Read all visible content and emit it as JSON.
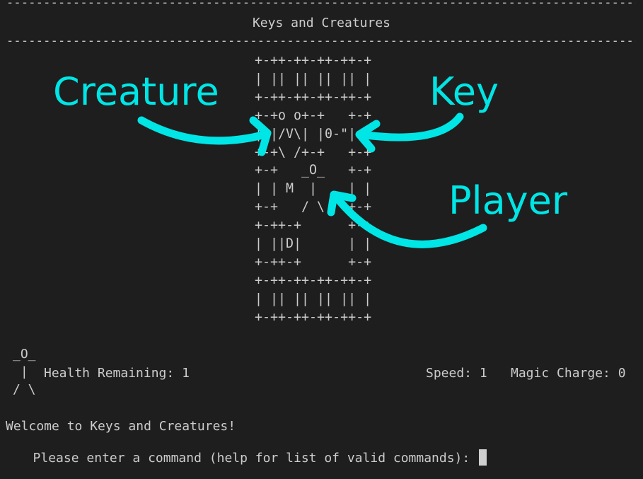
{
  "header": {
    "rule": "---------------------------------------------------------------------------------------------------------",
    "title": "Keys and Creatures"
  },
  "map": {
    "lines": [
      "+-++-++-++-++-+",
      "| || || || || |",
      "+-++-++-++-++-+",
      "+-+o o+-+   +-+",
      "| |/V\\| |0-\"| |",
      "+-+\\ /+-+   +-+",
      "+-+   _O_   +-+",
      "| | M  |    | |",
      "+-+   / \\   +-+",
      "+-++-+      +-+",
      "| ||D|      | |",
      "+-++-+      +-+",
      "+-++-++-++-++-+",
      "| || || || || |",
      "+-++-++-++-++-+"
    ]
  },
  "annotations": {
    "creature": "Creature",
    "key": "Key",
    "player": "Player",
    "color": "#00e5e5"
  },
  "hud": {
    "figure_lines": [
      "_O_",
      " |",
      "/ \\"
    ],
    "health_label": "Health Remaining: 1",
    "speed_label": "Speed: 1",
    "magic_label": "Magic Charge: 0"
  },
  "console": {
    "welcome": "Welcome to Keys and Creatures!",
    "prompt": "Please enter a command (help for list of valid commands): "
  }
}
